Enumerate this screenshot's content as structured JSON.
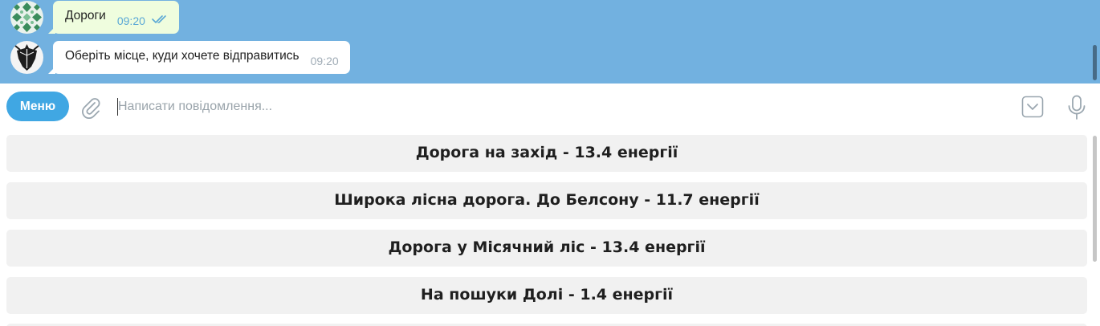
{
  "chat": {
    "messages": [
      {
        "direction": "outgoing",
        "avatar_icon": "green-pattern-avatar-icon",
        "text": "Дороги",
        "time": "09:20",
        "status_icon": "double-check-icon"
      },
      {
        "direction": "incoming",
        "avatar_icon": "bot-dark-emblem-avatar-icon",
        "text": "Оберіть місце, куди хочете відправитись",
        "time": "09:20"
      }
    ]
  },
  "composer": {
    "menu_label": "Меню",
    "input_value": "",
    "input_placeholder": "Написати повідомлення...",
    "attach_icon": "paperclip-icon",
    "keyboard_toggle_icon": "keyboard-collapse-icon",
    "mic_icon": "microphone-icon"
  },
  "keyboard": {
    "buttons": [
      {
        "label": "Дорога на захід - 13.4 енергії"
      },
      {
        "label": "Широка лісна дорога. До Белсону - 11.7 енергії"
      },
      {
        "label": "Дорога у Місячний ліс - 13.4 енергії"
      },
      {
        "label": "На пошуки Долі - 1.4 енергії"
      }
    ]
  },
  "colors": {
    "chat_background": "#72b1e0",
    "outgoing_bubble": "#effdde",
    "incoming_bubble": "#ffffff",
    "accent": "#40a7e3",
    "keyboard_button": "#f1f1f1"
  }
}
